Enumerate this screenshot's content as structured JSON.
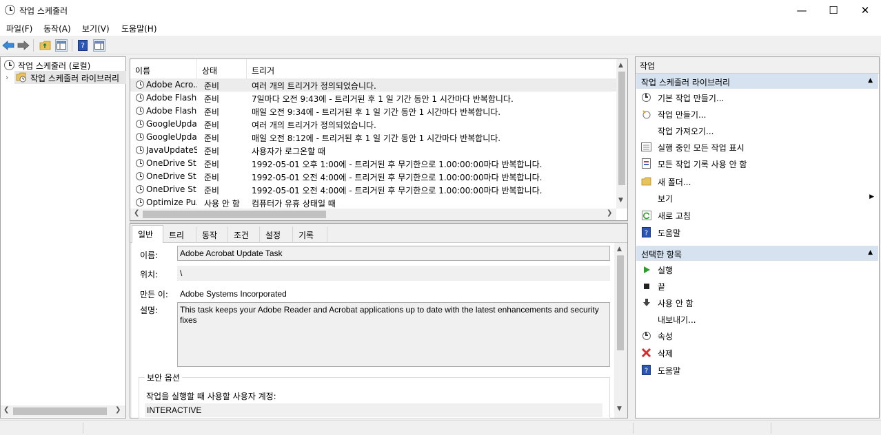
{
  "window": {
    "title": "작업 스케줄러"
  },
  "window_controls": {
    "minimize": "—",
    "maximize": "☐",
    "close": "✕"
  },
  "menu": [
    "파일(F)",
    "동작(A)",
    "보기(V)",
    "도움말(H)"
  ],
  "toolbar": {
    "back_icon": "back-arrow-icon",
    "forward_icon": "forward-arrow-icon",
    "up_folder_icon": "folder-up-icon",
    "show_hide_icon": "console-tree-icon",
    "help_icon": "help-icon",
    "action_pane_icon": "action-pane-icon"
  },
  "tree": {
    "root": "작업 스케줄러 (로컬)",
    "library": "작업 스케줄러 라이브러리"
  },
  "list": {
    "columns": [
      "이름",
      "상태",
      "트리거"
    ],
    "rows": [
      {
        "name": "Adobe Acro...",
        "status": "준비",
        "trigger": "여러 개의 트리거가 정의되었습니다."
      },
      {
        "name": "Adobe Flash...",
        "status": "준비",
        "trigger": "7일마다 오전 9:43에 - 트리거된 후 1 일 기간 동안 1 시간마다 반복합니다."
      },
      {
        "name": "Adobe Flash...",
        "status": "준비",
        "trigger": "매일 오전 9:34에 - 트리거된 후 1 일 기간 동안 1 시간마다 반복합니다."
      },
      {
        "name": "GoogleUpda...",
        "status": "준비",
        "trigger": "여러 개의 트리거가 정의되었습니다."
      },
      {
        "name": "GoogleUpda...",
        "status": "준비",
        "trigger": "매일 오전 8:12에 - 트리거된 후 1 일 기간 동안 1 시간마다 반복합니다."
      },
      {
        "name": "JavaUpdateS...",
        "status": "준비",
        "trigger": "사용자가 로그온할 때"
      },
      {
        "name": "OneDrive St...",
        "status": "준비",
        "trigger": "1992-05-01 오후 1:00에 - 트리거된 후 무기한으로 1.00:00:00마다 반복합니다."
      },
      {
        "name": "OneDrive St...",
        "status": "준비",
        "trigger": "1992-05-01 오전 4:00에 - 트리거된 후 무기한으로 1.00:00:00마다 반복합니다."
      },
      {
        "name": "OneDrive St...",
        "status": "준비",
        "trigger": "1992-05-01 오전 4:00에 - 트리거된 후 무기한으로 1.00:00:00마다 반복합니다."
      },
      {
        "name": "Optimize Pu...",
        "status": "사용 안 함",
        "trigger": "컴퓨터가 유휴 상태일 때"
      }
    ]
  },
  "details": {
    "tabs": [
      "일반",
      "트리거",
      "동작",
      "조건",
      "설정",
      "기록"
    ],
    "name_label": "이름:",
    "name_value": "Adobe Acrobat Update Task",
    "location_label": "위치:",
    "location_value": "\\",
    "author_label": "만든 이:",
    "author_value": "Adobe Systems Incorporated",
    "desc_label": "설명:",
    "desc_value": "This task keeps your Adobe Reader and Acrobat applications up to date with the latest enhancements and security fixes",
    "security_group": "보안 옵션",
    "account_label": "작업을 실행할 때 사용할 사용자 계정:",
    "account_value": "INTERACTIVE"
  },
  "actions": {
    "title": "작업",
    "section1": "작업 스케줄러 라이브러리",
    "items1": [
      {
        "icon": "clock-wand-icon",
        "label": "기본 작업 만들기..."
      },
      {
        "icon": "create-task-icon",
        "label": "작업 만들기..."
      },
      {
        "icon": "",
        "label": "작업 가져오기..."
      },
      {
        "icon": "running-tasks-icon",
        "label": "실행 중인 모든 작업 표시"
      },
      {
        "icon": "task-history-icon",
        "label": "모든 작업 기록 사용 안 함"
      },
      {
        "icon": "new-folder-icon",
        "label": "새 폴더..."
      },
      {
        "icon": "",
        "label": "보기"
      },
      {
        "icon": "refresh-icon",
        "label": "새로 고침"
      },
      {
        "icon": "help-icon",
        "label": "도움말"
      }
    ],
    "section2": "선택한 항목",
    "items2": [
      {
        "icon": "run-icon",
        "label": "실행"
      },
      {
        "icon": "end-icon",
        "label": "끝"
      },
      {
        "icon": "disable-icon",
        "label": "사용 안 함"
      },
      {
        "icon": "",
        "label": "내보내기..."
      },
      {
        "icon": "properties-icon",
        "label": "속성"
      },
      {
        "icon": "delete-icon",
        "label": "삭제"
      },
      {
        "icon": "help-icon",
        "label": "도움말"
      }
    ]
  },
  "colors": {
    "section_header_bg": "#d6e2f0",
    "selection_bg": "#ececec",
    "delete_red": "#d62e2e",
    "run_green": "#2c9e2c",
    "help_blue": "#2b56b8"
  }
}
